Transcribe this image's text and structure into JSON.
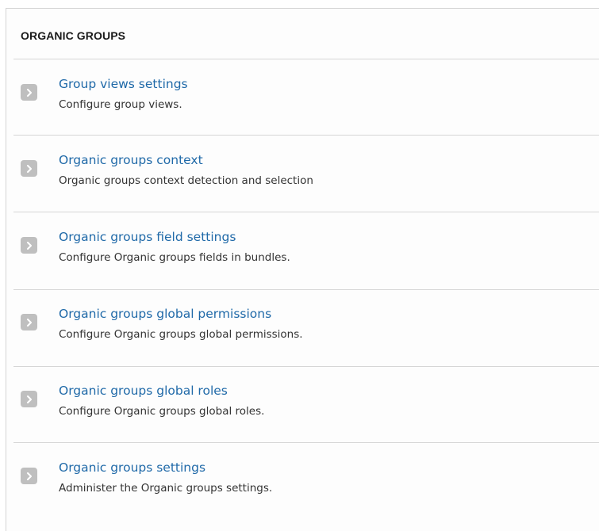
{
  "section": {
    "title": "ORGANIC GROUPS"
  },
  "icons": {
    "expand": "chevron-right-icon"
  },
  "colors": {
    "link": "#1f69a8",
    "chevron_bg": "#bfbfbf",
    "divider": "#d6d6d6"
  },
  "items": [
    {
      "label": "Group views settings",
      "description": "Configure group views."
    },
    {
      "label": "Organic groups context",
      "description": "Organic groups context detection and selection"
    },
    {
      "label": "Organic groups field settings",
      "description": "Configure Organic groups fields in bundles."
    },
    {
      "label": "Organic groups global permissions",
      "description": "Configure Organic groups global permissions."
    },
    {
      "label": "Organic groups global roles",
      "description": "Configure Organic groups global roles."
    },
    {
      "label": "Organic groups settings",
      "description": "Administer the Organic groups settings."
    }
  ]
}
